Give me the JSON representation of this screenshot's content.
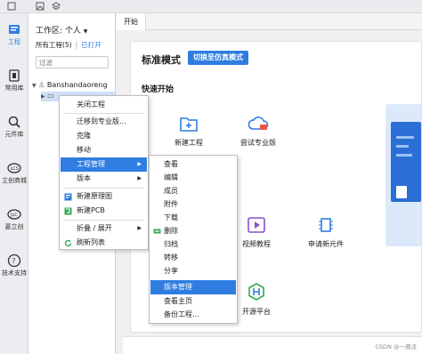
{
  "leftbar": {
    "items": [
      {
        "label": "工程",
        "icon": "project-icon"
      },
      {
        "label": "常用库",
        "icon": "library-icon"
      },
      {
        "label": "元件库",
        "icon": "component-search-icon"
      },
      {
        "label": "立创商城",
        "icon": "lcsc-icon"
      },
      {
        "label": "嘉立创",
        "icon": "jlc-icon"
      },
      {
        "label": "技术支持",
        "icon": "help-icon"
      }
    ]
  },
  "panel": {
    "workspace_label": "工作区: 个人",
    "tab_all": "所有工程(5)",
    "tab_open": "已打开",
    "filter_placeholder": "过滤",
    "tree": {
      "root": "Banshandaoreng",
      "selected_project": ""
    }
  },
  "tabs": [
    {
      "label": "开始"
    }
  ],
  "start": {
    "mode_title": "标准模式",
    "mode_switch": "切换至仿真模式",
    "quick_title": "快速开始",
    "quick_items": [
      {
        "label": "新建工程",
        "icon": "new-folder-icon"
      },
      {
        "label": "尝试专业版",
        "icon": "cloud-pro-icon"
      },
      {
        "label": "视频教程",
        "icon": "video-icon"
      },
      {
        "label": "申请新元件",
        "icon": "new-component-icon"
      },
      {
        "label": "开源平台",
        "icon": "open-source-icon"
      }
    ]
  },
  "context_menu": {
    "items": [
      {
        "label": "关闭工程"
      },
      {
        "label": "迁移到专业版..."
      },
      {
        "label": "克隆"
      },
      {
        "label": "移动"
      },
      {
        "label": "工程管理",
        "submenu": true
      },
      {
        "label": "版本",
        "submenu": true
      },
      {
        "label": "新建原理图"
      },
      {
        "label": "新建PCB"
      },
      {
        "label": "折叠 / 展开",
        "submenu": true
      },
      {
        "label": "刷新列表"
      }
    ]
  },
  "submenu": {
    "items": [
      {
        "label": "查看"
      },
      {
        "label": "编辑"
      },
      {
        "label": "成员"
      },
      {
        "label": "附件"
      },
      {
        "label": "下载"
      },
      {
        "label": "删除"
      },
      {
        "label": "归档"
      },
      {
        "label": "转移"
      },
      {
        "label": "分享"
      },
      {
        "label": "版本管理"
      },
      {
        "label": "查看主页"
      },
      {
        "label": "备份工程..."
      }
    ]
  },
  "footer": {
    "watermark": "CSDN @一周法"
  },
  "colors": {
    "accent": "#2f7de1"
  }
}
